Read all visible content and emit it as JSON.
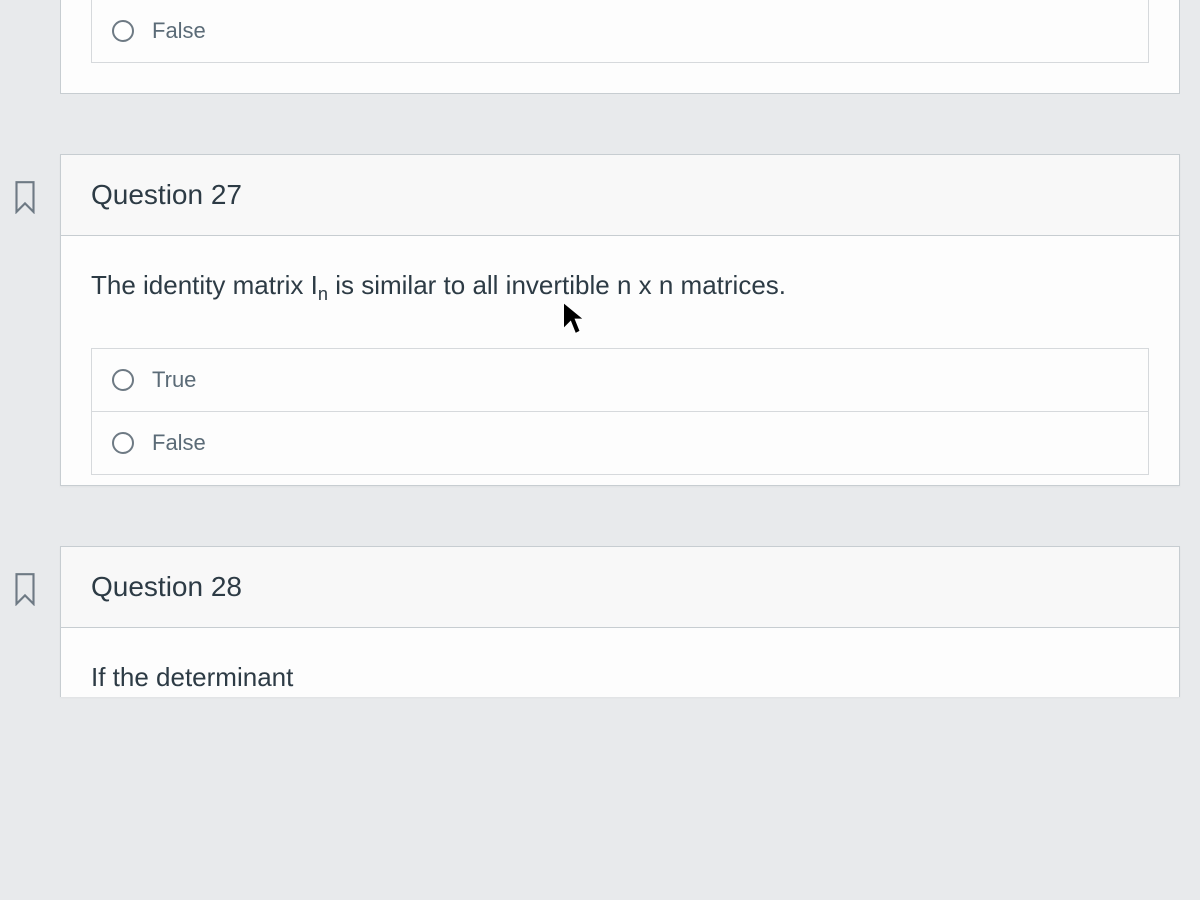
{
  "prev_question": {
    "options": [
      {
        "label": "False"
      }
    ]
  },
  "question_27": {
    "header": "Question 27",
    "prompt_pre": "The identity matrix I",
    "prompt_sub": "n",
    "prompt_post": " is similar to all invertible n x n matrices.",
    "options": [
      {
        "label": "True"
      },
      {
        "label": "False"
      }
    ]
  },
  "question_28": {
    "header": "Question 28",
    "prompt_visible": "If the determinant"
  }
}
